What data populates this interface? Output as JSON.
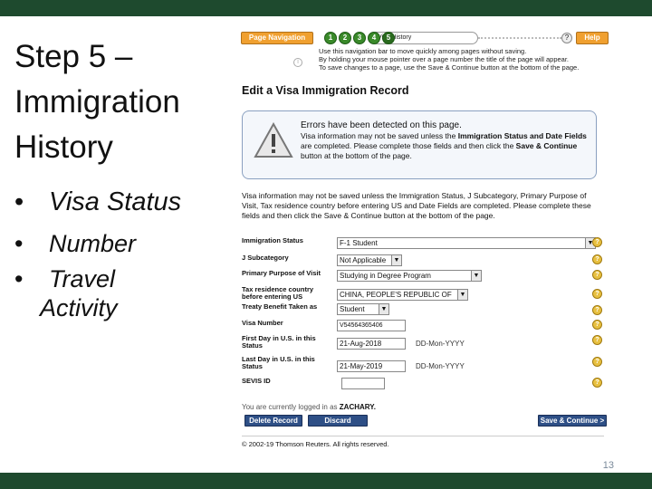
{
  "slide": {
    "title_lines": [
      "Step 5 –",
      "Immigration",
      "History"
    ],
    "bullets": [
      "Visa Status",
      "Number",
      "Travel",
      "Activity"
    ],
    "slide_number": "13"
  },
  "screenshot": {
    "nav": {
      "button_label": "Page Navigation",
      "page_numbers": [
        "1",
        "2",
        "3",
        "4",
        "5"
      ],
      "current_page_label": "Visa History",
      "help_icon": "?",
      "help_label": "Help",
      "instructions": [
        "Use this navigation bar to move quickly among pages without saving.",
        "By holding your mouse pointer over a page number the title of the page will appear.",
        "To save changes to a page, use the Save & Continue button at the bottom of the page."
      ]
    },
    "page_title": "Edit a Visa Immigration Record",
    "error": {
      "title": "Errors have been detected on this page.",
      "text_1": "Visa information may not be saved unless the ",
      "text_bold_1": "Immigration Status and Date Fields",
      "text_2": " are completed. Please complete those fields and then click the ",
      "text_bold_2": "Save & Continue",
      "text_3": " button at the bottom of the page."
    },
    "description": "Visa information may not be saved unless the Immigration Status, J Subcategory, Primary Purpose of Visit, Tax residence country before entering US and Date Fields are completed. Please complete these fields and then click the Save & Continue button at the bottom of the page.",
    "form": {
      "immigration_status": {
        "label": "Immigration Status",
        "value": "F-1 Student"
      },
      "j_subcategory": {
        "label": "J Subcategory",
        "value": "Not Applicable"
      },
      "primary_purpose": {
        "label": "Primary Purpose of Visit",
        "value": "Studying in Degree Program"
      },
      "tax_residence": {
        "label": "Tax residence country before entering US",
        "value": "CHINA, PEOPLE'S REPUBLIC OF"
      },
      "treaty_benefit": {
        "label": "Treaty Benefit Taken as",
        "value": "Student"
      },
      "visa_number": {
        "label": "Visa Number",
        "value": "V54564365406"
      },
      "first_day": {
        "label": "First Day in U.S. in this Status",
        "value": "21-Aug-2018",
        "format": "DD-Mon-YYYY"
      },
      "last_day": {
        "label": "Last Day in U.S. in this Status",
        "value": "21-May-2019",
        "format": "DD-Mon-YYYY"
      },
      "sevis_id": {
        "label": "SEVIS ID",
        "value": ""
      }
    },
    "logged_in_prefix": "You are currently logged in as ",
    "logged_in_user": "ZACHARY.",
    "buttons": {
      "delete": "Delete Record",
      "discard": "Discard Changes",
      "save": "Save & Continue >"
    },
    "copyright": "© 2002-19 Thomson Reuters. All rights reserved."
  }
}
